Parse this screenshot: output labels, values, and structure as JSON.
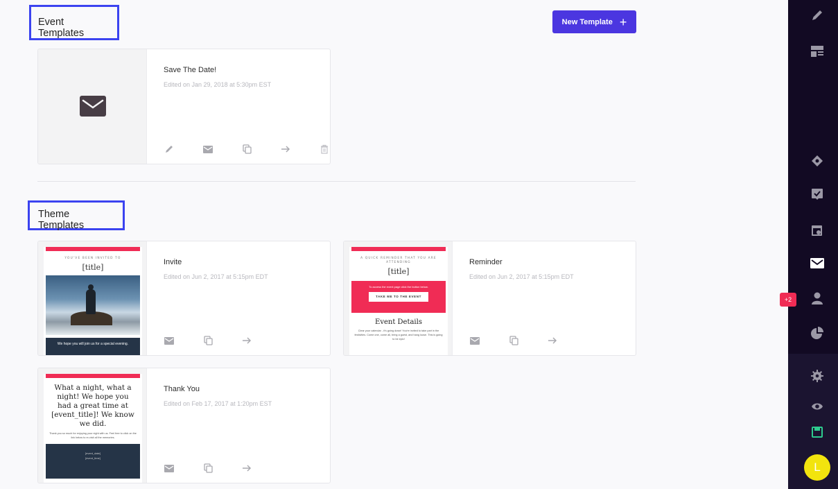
{
  "event_section": {
    "title": "Event Templates",
    "new_button_label": "New Template",
    "new_button_icon": "plus-icon",
    "cards": [
      {
        "name": "Save The Date!",
        "edited": "Edited on Jan 29, 2018 at 5:30pm EST",
        "thumbnail_icon": "envelope-icon"
      }
    ]
  },
  "theme_section": {
    "title": "Theme Templates",
    "cards": [
      {
        "name": "Invite",
        "edited": "Edited on Jun 2, 2017 at 5:15pm EDT",
        "preview": {
          "kicker": "YOU'VE BEEN INVITED TO",
          "title": "[title]",
          "footer": "We hope you will join us for a special evening."
        }
      },
      {
        "name": "Reminder",
        "edited": "Edited on Jun 2, 2017 at 5:15pm EDT",
        "preview": {
          "kicker": "A QUICK REMINDER THAT YOU ARE ATTENDING",
          "title": "[title]",
          "box_text": "To access the event page click the button below.",
          "button": "TAKE ME TO THE EVENT",
          "details_heading": "Event Details",
          "details_text": "Clear your calendar - it's going down! You're invited to take part in the festivities. Come one, come all, bring a guest, and hang loose. This is going to be epic!"
        }
      },
      {
        "name": "Thank You",
        "edited": "Edited on Feb 17, 2017 at 1:20pm EST",
        "preview": {
          "heading": "What a night, what a night! We hope you had a great time at [event_title]! We know we did.",
          "body": "Thank you so much for enjoying your night with us. Feel free to click on the link below to re-visit all the memories.",
          "line1": "[event_date]",
          "line2": "[event_time]"
        }
      }
    ]
  },
  "sidebar": {
    "badge": "+2",
    "avatar_initial": "L",
    "icons": [
      "pencil-icon",
      "layout-icon",
      "ticket-icon",
      "checkbox-icon",
      "calendar-icon",
      "mail-icon",
      "person-icon",
      "pie-chart-icon",
      "gear-icon",
      "eye-icon",
      "save-icon"
    ],
    "accent": "#2ecc8f"
  },
  "colors": {
    "primary": "#4b36e0",
    "highlight_border": "#3b43f0",
    "brand_pink": "#f02c55",
    "sidebar_bg": "#120a23"
  }
}
